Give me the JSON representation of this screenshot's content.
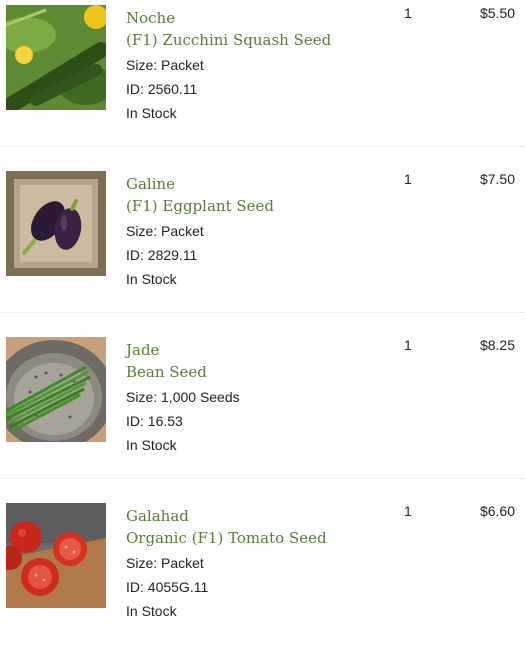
{
  "cart_items": [
    {
      "name_line1": "Noche",
      "name_line2": "(F1) Zucchini Squash Seed",
      "size": "Size: Packet",
      "id": "ID: 2560.11",
      "stock": "In Stock",
      "quantity": "1",
      "price": "$5.50",
      "image_icon": "zucchini-photo"
    },
    {
      "name_line1": "Galine",
      "name_line2": "(F1) Eggplant Seed",
      "size": "Size: Packet",
      "id": "ID: 2829.11",
      "stock": "In Stock",
      "quantity": "1",
      "price": "$7.50",
      "image_icon": "eggplant-photo"
    },
    {
      "name_line1": "Jade",
      "name_line2": "Bean Seed",
      "size": "Size: 1,000 Seeds",
      "id": "ID: 16.53",
      "stock": "In Stock",
      "quantity": "1",
      "price": "$8.25",
      "image_icon": "bean-photo"
    },
    {
      "name_line1": "Galahad",
      "name_line2": "Organic (F1) Tomato Seed",
      "size": "Size: Packet",
      "id": "ID: 4055G.11",
      "stock": "In Stock",
      "quantity": "1",
      "price": "$6.60",
      "image_icon": "tomato-photo"
    }
  ],
  "colors": {
    "product_name": "#5b7a38",
    "text": "#222222",
    "separator": "#e3e3e3"
  }
}
